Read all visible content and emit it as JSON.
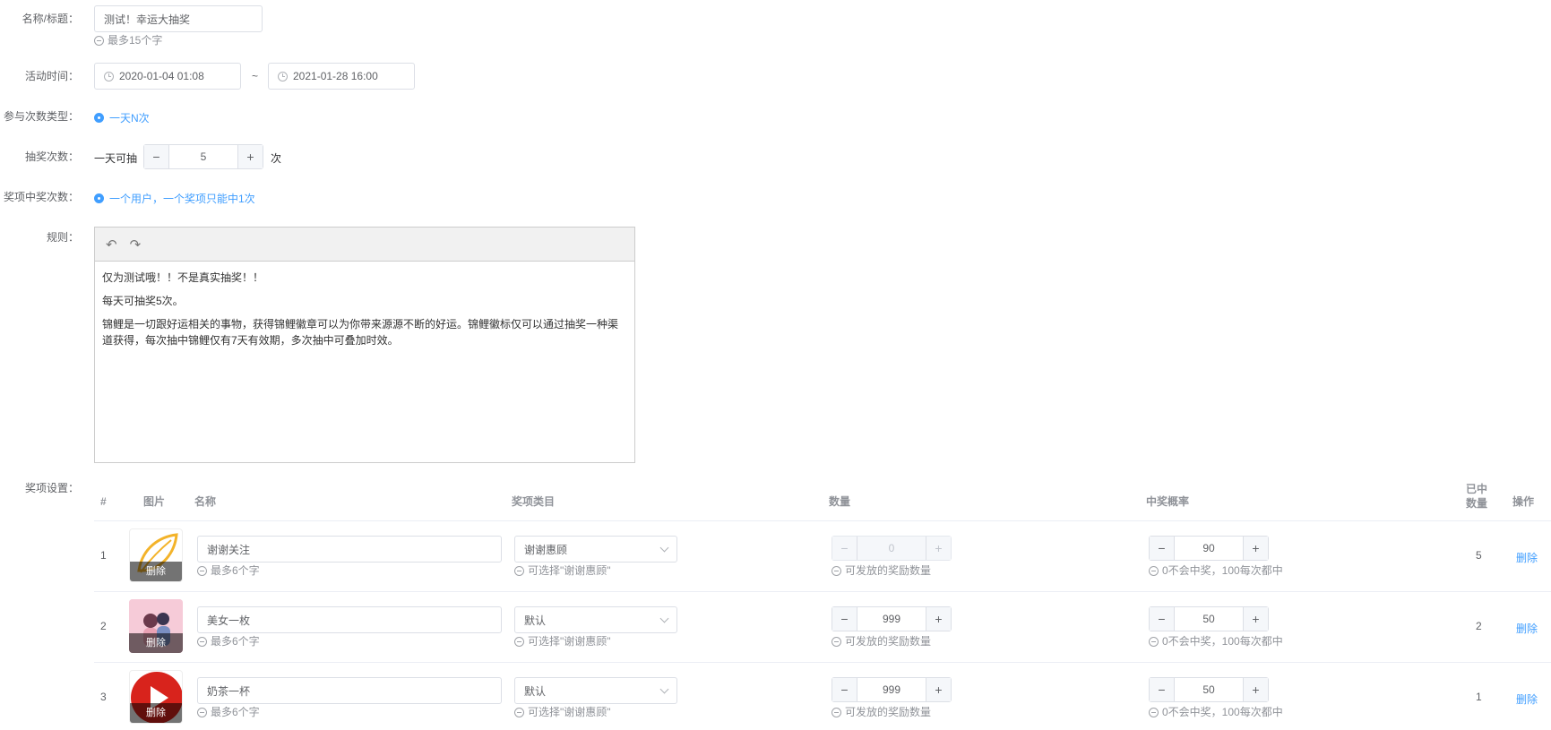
{
  "form": {
    "title_label": "名称/标题：",
    "title_value": "测试！幸运大抽奖",
    "title_hint": "最多15个字",
    "time_label": "活动时间：",
    "time_start": "2020-01-04 01:08",
    "time_sep": "~",
    "time_end": "2021-01-28 16:00",
    "participate_label": "参与次数类型：",
    "participate_option": "一天N次",
    "draw_label": "抽奖次数：",
    "draw_prefix": "一天可抽",
    "draw_value": "5",
    "draw_suffix": "次",
    "win_label": "奖项中奖次数：",
    "win_option": "一个用户，一个奖项只能中1次",
    "rules_label": "规则：",
    "rules_lines": [
      "仅为测试哦！！不是真实抽奖！！",
      "每天可抽奖5次。",
      "锦鲤是一切跟好运相关的事物，获得锦鲤徽章可以为你带来源源不断的好运。锦鲤徽标仅可以通过抽奖一种渠道获得，每次抽中锦鲤仅有7天有效期，多次抽中可叠加时效。"
    ],
    "prizes_label": "奖项设置："
  },
  "table": {
    "headers": {
      "index": "#",
      "image": "图片",
      "name": "名称",
      "category": "奖项类目",
      "quantity": "数量",
      "probability": "中奖概率",
      "won": "已中数量",
      "action": "操作"
    },
    "name_hint": "最多6个字",
    "category_hint": "可选择\"谢谢惠顾\"",
    "quantity_hint": "可发放的奖励数量",
    "probability_hint": "0不会中奖，100每次都中",
    "thumb_delete": "删除",
    "action_delete": "删除",
    "rows": [
      {
        "index": "1",
        "name": "谢谢关注",
        "category": "谢谢惠顾",
        "quantity": "0",
        "probability": "90",
        "won": "5",
        "thumb": "leaf-icon"
      },
      {
        "index": "2",
        "name": "美女一枚",
        "category": "默认",
        "quantity": "999",
        "probability": "50",
        "won": "2",
        "thumb": "couple-illustration"
      },
      {
        "index": "3",
        "name": "奶茶一杯",
        "category": "默认",
        "quantity": "999",
        "probability": "50",
        "won": "1",
        "thumb": "play-icon"
      }
    ]
  }
}
